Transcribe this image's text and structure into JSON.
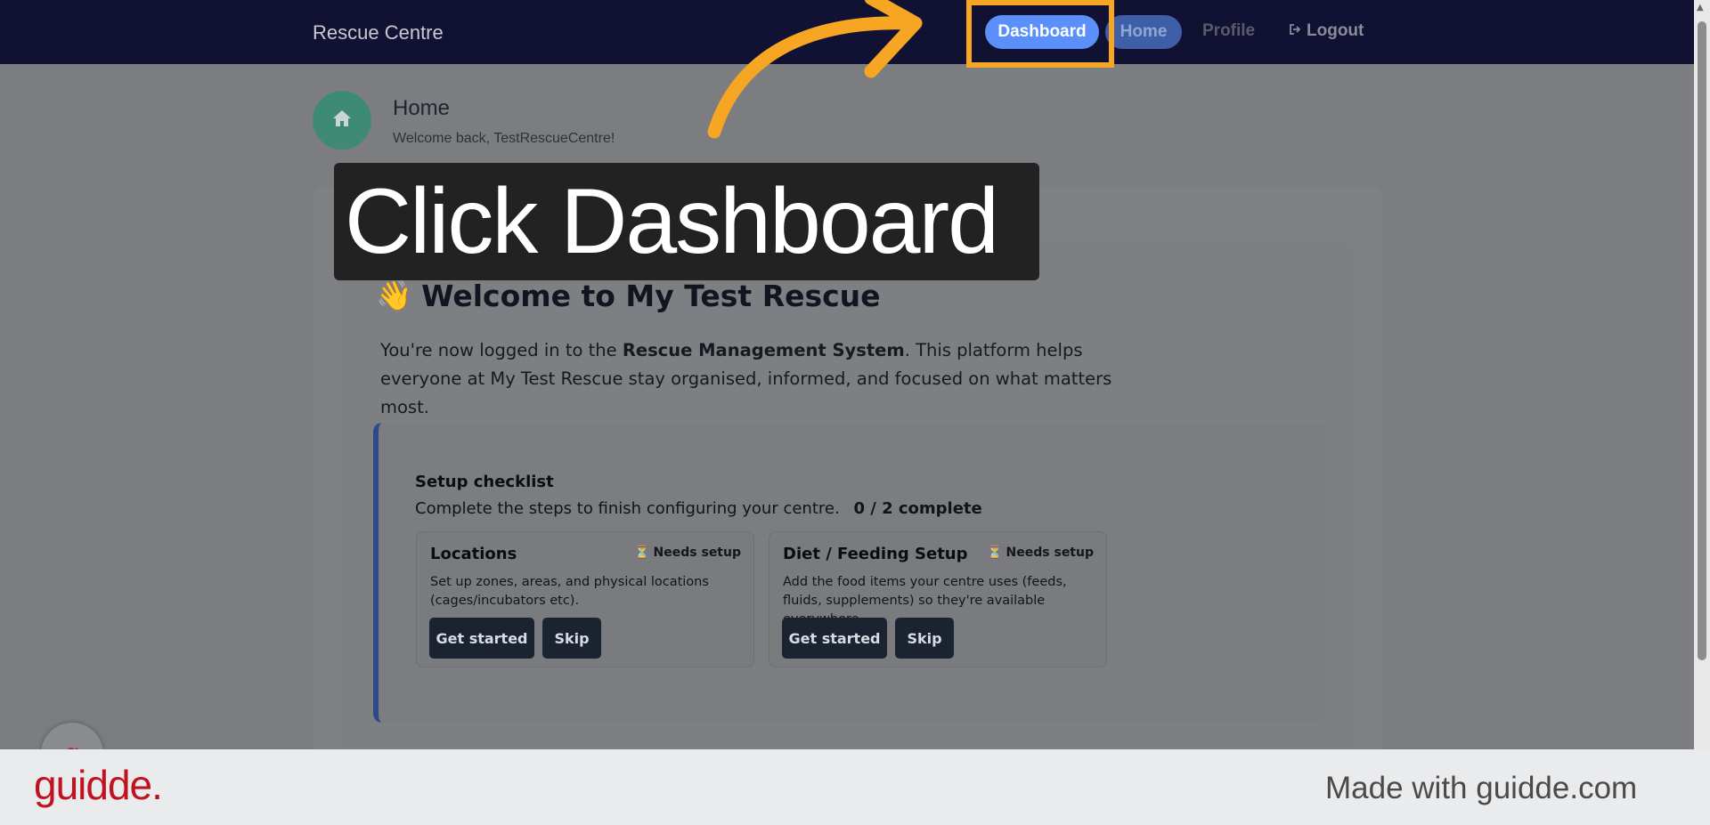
{
  "header": {
    "brand": "Rescue Centre",
    "nav": {
      "dashboard": "Dashboard",
      "home": "Home",
      "profile": "Profile",
      "logout": "Logout"
    }
  },
  "page": {
    "title": "Home",
    "subtitle": "Welcome back, TestRescueCentre!"
  },
  "welcome": {
    "emoji": "👋",
    "heading": "Welcome to My Test Rescue",
    "text_before": "You're now logged in to the ",
    "text_bold": "Rescue Management System",
    "text_after": ". This platform helps everyone at My Test Rescue stay organised, informed, and focused on what matters most."
  },
  "checklist": {
    "title": "Setup checklist",
    "subtitle": "Complete the steps to finish configuring your centre.",
    "progress": "0 / 2 complete",
    "steps": [
      {
        "title": "Locations",
        "badge": "Needs setup",
        "description": "Set up zones, areas, and physical locations (cages/incubators etc).",
        "start_label": "Get started",
        "skip_label": "Skip"
      },
      {
        "title": "Diet / Feeding Setup",
        "badge": "Needs setup",
        "description": "Add the food items your centre uses (feeds, fluids, supplements) so they're available everywhere.",
        "start_label": "Get started",
        "skip_label": "Skip"
      }
    ]
  },
  "overlay": {
    "caption": "Click Dashboard",
    "highlight_color": "#f6a623"
  },
  "footer": {
    "logo": "guidde.",
    "made_with": "Made with guidde.com"
  },
  "help_bubble": {
    "glyph": "g"
  },
  "colors": {
    "nav_bg": "#111233",
    "accent_blue": "#5b8ff9",
    "brand_red": "#c1121f"
  }
}
